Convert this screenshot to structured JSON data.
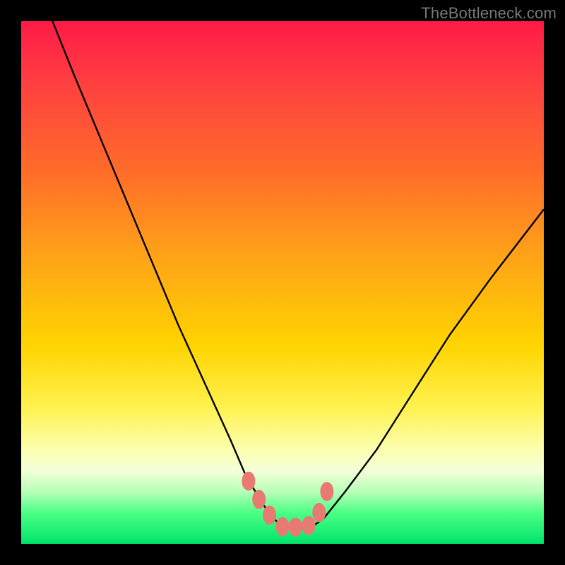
{
  "watermark": "TheBottleneck.com",
  "chart_data": {
    "type": "line",
    "title": "",
    "xlabel": "",
    "ylabel": "",
    "xlim": [
      0,
      100
    ],
    "ylim": [
      0,
      100
    ],
    "series": [
      {
        "name": "bottleneck-curve",
        "x": [
          6,
          10,
          15,
          20,
          25,
          30,
          35,
          40,
          43,
          46,
          48,
          50,
          52,
          54,
          56,
          58,
          62,
          68,
          75,
          82,
          90,
          100
        ],
        "values": [
          100,
          90,
          78,
          66,
          54,
          42,
          31,
          20,
          13,
          8,
          5,
          3.5,
          3,
          3,
          3.5,
          5,
          10,
          18,
          29,
          40,
          51,
          64
        ]
      }
    ],
    "markers": {
      "name": "highlight-dots",
      "color": "#e77a72",
      "x": [
        43.5,
        45.5,
        47.5,
        50,
        52.5,
        55,
        57,
        58.5
      ],
      "values": [
        12,
        8.5,
        5.5,
        3.3,
        3.2,
        3.5,
        6,
        10
      ]
    },
    "gradient_meaning": "green-good red-bad"
  }
}
